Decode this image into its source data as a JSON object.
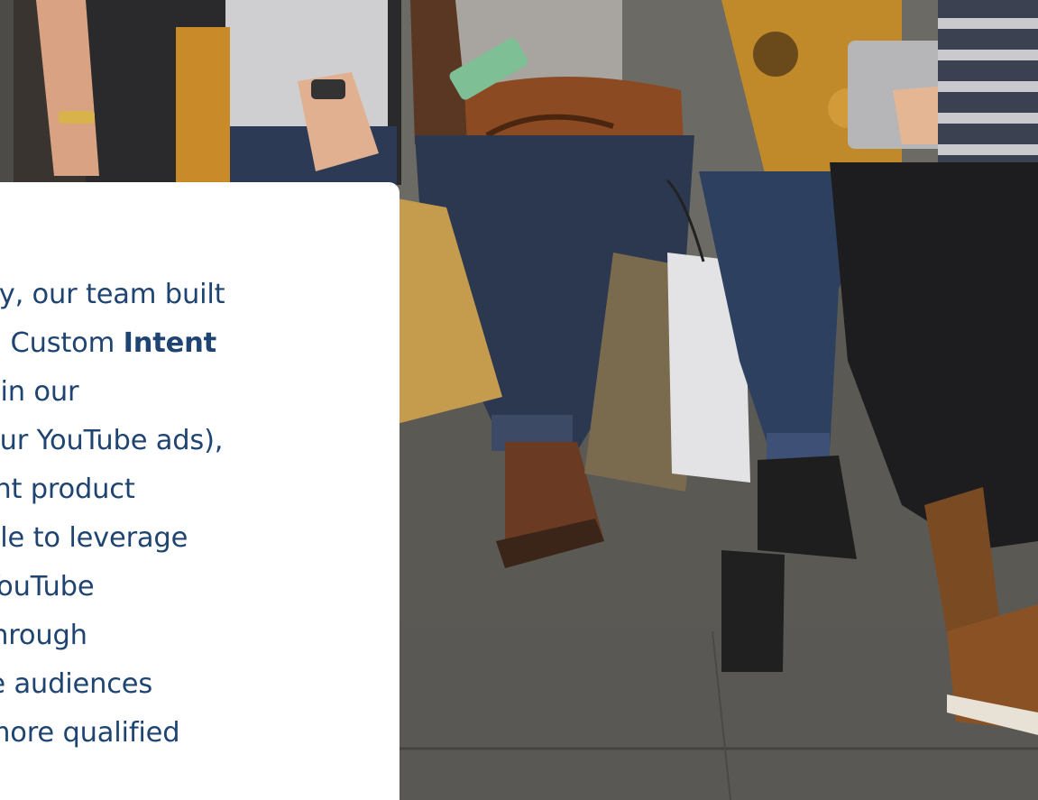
{
  "photo": {
    "icon": "shoppers-photo",
    "description_colors": {
      "backdrop": "#4a4a47",
      "bench": "#5b5a55",
      "pavement": "#575653"
    }
  },
  "card": {
    "lines": [
      "tively, our team built",
      "ated Custom ",
      "rms in our",
      "ed our YouTube ads),",
      "ferent product",
      "n able to leverage",
      "nd YouTube",
      "ns through",
      "hese audiences",
      "ng more qualified"
    ],
    "bold_word": "Intent",
    "text_color": "#1f4472"
  }
}
